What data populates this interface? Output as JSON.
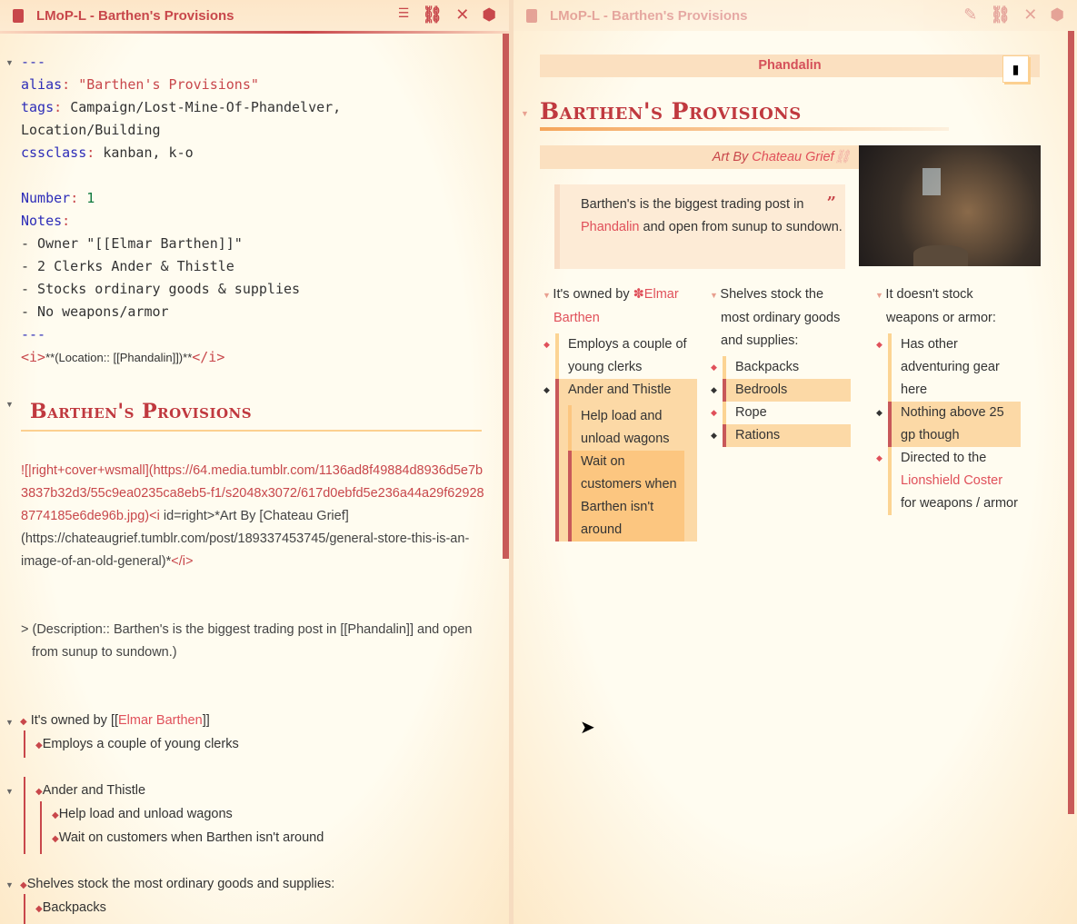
{
  "left": {
    "title": "LMoP-L - Barthen's Provisions",
    "source": {
      "dashes": "---",
      "alias_key": "alias",
      "alias_val": "\"Barthen's Provisions\"",
      "tags_key": "tags",
      "tags_val": "Campaign/Lost-Mine-Of-Phandelver,",
      "tags_val2": "Location/Building",
      "css_key": "cssclass",
      "css_val": "kanban, k-o",
      "number_key": "Number",
      "number_val": "1",
      "notes_key": "Notes",
      "notes": [
        "- Owner \"[[Elmar Barthen]]\"",
        "- 2 Clerks Ander & Thistle",
        "- Stocks ordinary goods & supplies",
        "- No weapons/armor"
      ],
      "location_line_open": "<i>",
      "location_line": "**(Location:: [[Phandalin]])**",
      "location_line_close": "</i>"
    },
    "heading": "Barthen's Provisions",
    "image_line": {
      "a": "![|right+cover+wsmall](https://64.media.tumblr.com/1136ad8f49884d8936d5e7b3837b32d3/55c9ea0235ca8eb5-f1/s2048x3072/617d0ebfd5e236a44a29f629288774185e6de96b.jpg)",
      "b": "<i",
      "c": " id=right>",
      "d": "*Art By [Chateau Grief](https://chateaugrief.tumblr.com/post/189337453745/general-store-this-is-an-image-of-an-old-general)*",
      "e": "</i>"
    },
    "description": "> (Description:: Barthen's is the biggest trading post in [[Phandalin]] and open from sunup to sundown.)",
    "list": {
      "owned_pre": "It's owned by [[",
      "owned_link": "Elmar Barthen",
      "owned_post": "]]",
      "employs": "Employs a couple of young clerks",
      "ander": "Ander and Thistle",
      "help": "Help load and unload wagons",
      "wait": "Wait on customers when Barthen isn't around",
      "shelves": "Shelves stock the most ordinary goods and supplies:",
      "backpacks": "Backpacks"
    }
  },
  "right": {
    "title": "LMoP-L - Barthen's Provisions",
    "banner": "Phandalin",
    "heading": "Barthen's Provisions",
    "art_by": "Art By",
    "art_name": "Chateau Grief",
    "quote": {
      "a": "Barthen's is the biggest trading post in",
      "link": "Phandalin",
      "b": "and open from sunup to sundown."
    },
    "col1": {
      "head_a": "It's owned by",
      "head_link": "Elmar Barthen",
      "items": [
        "Employs a couple of young clerks",
        "Ander and Thistle"
      ],
      "sub": [
        "Help load and unload wagons",
        "Wait on customers when Barthen isn't around"
      ]
    },
    "col2": {
      "head": "Shelves stock the most ordinary goods and supplies:",
      "items": [
        "Backpacks",
        "Bedrools",
        "Rope",
        "Rations"
      ]
    },
    "col3": {
      "head": "It doesn't stock weapons or armor:",
      "items": [
        "Has other adventuring gear here",
        "Nothing above 25 gp though"
      ],
      "dir_a": "Directed to the",
      "dir_link": "Lionshield Coster",
      "dir_b": "for weapons / armor"
    }
  },
  "colors": {
    "accent": "#c8474b",
    "highlight": "#fcd9a6"
  }
}
